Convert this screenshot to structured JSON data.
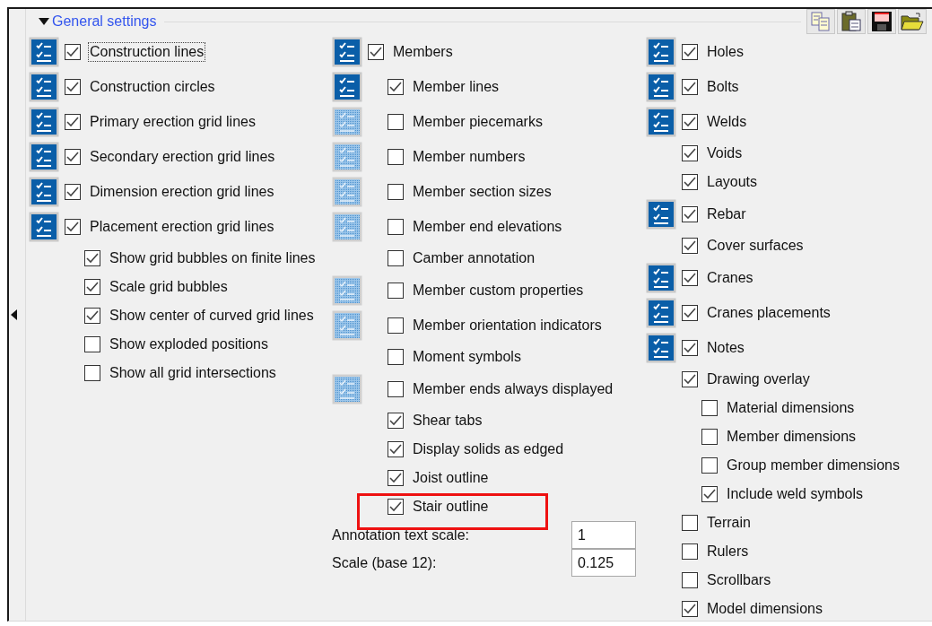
{
  "panel": {
    "title": "General settings",
    "expanded": true
  },
  "columns": [
    [
      {
        "label": "Construction lines",
        "checked": true,
        "filter": true,
        "focused": true
      },
      {
        "label": "Construction circles",
        "checked": true,
        "filter": true
      },
      {
        "label": "Primary erection grid lines",
        "checked": true,
        "filter": true
      },
      {
        "label": "Secondary erection grid lines",
        "checked": true,
        "filter": true
      },
      {
        "label": "Dimension erection grid lines",
        "checked": true,
        "filter": true
      },
      {
        "label": "Placement erection grid lines",
        "checked": true,
        "filter": true,
        "children": [
          {
            "label": "Show grid bubbles on finite lines",
            "checked": true
          },
          {
            "label": "Scale grid bubbles",
            "checked": true
          },
          {
            "label": "Show center of curved grid lines",
            "checked": true
          },
          {
            "label": "Show exploded positions",
            "checked": false
          },
          {
            "label": "Show all grid intersections",
            "checked": false
          }
        ]
      }
    ],
    [
      {
        "label": "Members",
        "checked": true,
        "filter": true,
        "children": [
          {
            "label": "Member lines",
            "checked": true,
            "filter": true
          },
          {
            "label": "Member piecemarks",
            "checked": false,
            "filter": false
          },
          {
            "label": "Member numbers",
            "checked": false,
            "filter": false
          },
          {
            "label": "Member section sizes",
            "checked": false,
            "filter": false
          },
          {
            "label": "Member end elevations",
            "checked": false,
            "filter": false
          },
          {
            "label": "Camber annotation",
            "checked": false
          },
          {
            "label": "Member custom properties",
            "checked": false,
            "filter": false
          },
          {
            "label": "Member orientation indicators",
            "checked": false,
            "filter": false
          },
          {
            "label": "Moment symbols",
            "checked": false
          },
          {
            "label": "Member ends always displayed",
            "checked": false,
            "filter": false
          },
          {
            "label": "Shear tabs",
            "checked": true
          },
          {
            "label": "Display solids as edged",
            "checked": true
          },
          {
            "label": "Joist outline",
            "checked": true
          },
          {
            "label": "Stair outline",
            "checked": true,
            "highlighted": true
          }
        ]
      }
    ],
    [
      {
        "label": "Holes",
        "checked": true,
        "filter": true
      },
      {
        "label": "Bolts",
        "checked": true,
        "filter": true
      },
      {
        "label": "Welds",
        "checked": true,
        "filter": true
      },
      {
        "label": "Voids",
        "checked": true
      },
      {
        "label": "Layouts",
        "checked": true
      },
      {
        "label": "Rebar",
        "checked": true,
        "filter": true
      },
      {
        "label": "Cover surfaces",
        "checked": true
      },
      {
        "label": "Cranes",
        "checked": true,
        "filter": true
      },
      {
        "label": "Cranes placements",
        "checked": true,
        "filter": true
      },
      {
        "label": "Notes",
        "checked": true,
        "filter": true
      },
      {
        "label": "Drawing overlay",
        "checked": true,
        "children": [
          {
            "label": "Material dimensions",
            "checked": false
          },
          {
            "label": "Member dimensions",
            "checked": false
          },
          {
            "label": "Group member dimensions",
            "checked": false
          },
          {
            "label": "Include weld symbols",
            "checked": true
          }
        ]
      },
      {
        "label": "Terrain",
        "checked": false
      },
      {
        "label": "Rulers",
        "checked": false
      },
      {
        "label": "Scrollbars",
        "checked": false
      },
      {
        "label": "Model dimensions",
        "checked": true
      }
    ]
  ],
  "fields": [
    {
      "label": "Annotation text scale:",
      "value": "1"
    },
    {
      "label": "Scale (base 12):",
      "value": "0.125"
    }
  ]
}
